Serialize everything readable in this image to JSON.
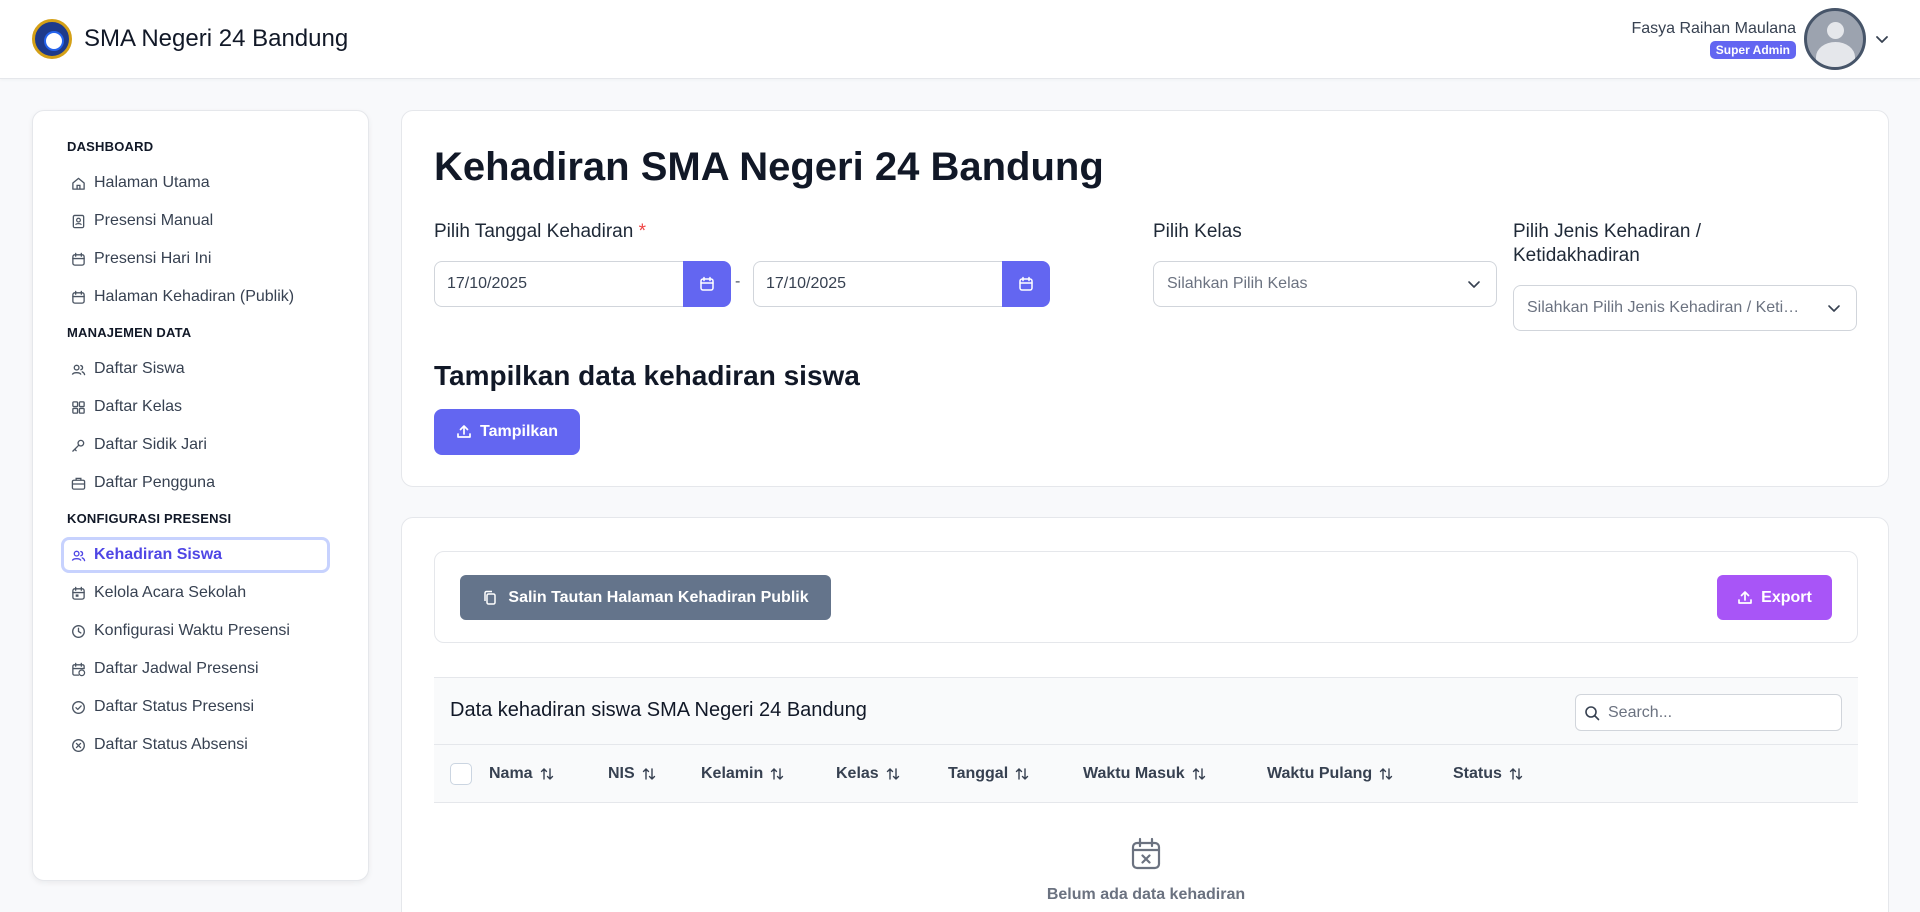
{
  "header": {
    "school_name": "SMA Negeri 24 Bandung",
    "user_name": "Fasya Raihan Maulana",
    "user_role": "Super Admin"
  },
  "sidebar": {
    "sections": [
      {
        "title": "DASHBOARD",
        "items": [
          {
            "label": "Halaman Utama",
            "icon": "home-icon"
          },
          {
            "label": "Presensi Manual",
            "icon": "contact-card-icon"
          },
          {
            "label": "Presensi Hari Ini",
            "icon": "calendar-icon"
          },
          {
            "label": "Halaman Kehadiran (Publik)",
            "icon": "calendar-icon"
          }
        ]
      },
      {
        "title": "MANAJEMEN DATA",
        "items": [
          {
            "label": "Daftar Siswa",
            "icon": "users-icon"
          },
          {
            "label": "Daftar Kelas",
            "icon": "grid-icon"
          },
          {
            "label": "Daftar Sidik Jari",
            "icon": "key-icon"
          },
          {
            "label": "Daftar Pengguna",
            "icon": "briefcase-icon"
          }
        ]
      },
      {
        "title": "KONFIGURASI PRESENSI",
        "items": [
          {
            "label": "Kehadiran Siswa",
            "icon": "users-icon",
            "active": true
          },
          {
            "label": "Kelola Acara Sekolah",
            "icon": "calendar-event-icon"
          },
          {
            "label": "Konfigurasi Waktu Presensi",
            "icon": "clock-icon"
          },
          {
            "label": "Daftar Jadwal Presensi",
            "icon": "calendar-clock-icon"
          },
          {
            "label": "Daftar Status Presensi",
            "icon": "check-circle-icon"
          },
          {
            "label": "Daftar Status Absensi",
            "icon": "x-circle-icon"
          }
        ]
      }
    ]
  },
  "filter_card": {
    "title": "Kehadiran SMA Negeri 24 Bandung",
    "date_label": "Pilih Tanggal Kehadiran",
    "required_mark": "*",
    "date_from": "17/10/2025",
    "date_separator": "-",
    "date_to": "17/10/2025",
    "class_label": "Pilih Kelas",
    "class_placeholder": "Silahkan Pilih Kelas",
    "type_label": "Pilih Jenis Kehadiran / Ketidakhadiran",
    "type_placeholder": "Silahkan Pilih Jenis Kehadiran / Ketidakhadiran",
    "show_title": "Tampilkan data kehadiran siswa",
    "show_button": "Tampilkan"
  },
  "data_card": {
    "copy_button": "Salin Tautan Halaman Kehadiran Publik",
    "export_button": "Export",
    "table_title": "Data kehadiran siswa SMA Negeri 24 Bandung",
    "search_placeholder": "Search...",
    "columns": [
      "Nama",
      "NIS",
      "Kelamin",
      "Kelas",
      "Tanggal",
      "Waktu Masuk",
      "Waktu Pulang",
      "Status"
    ],
    "empty_text": "Belum ada data kehadiran"
  },
  "colors": {
    "primary": "#6366f1",
    "export": "#a855f7",
    "copy": "#64748b",
    "required": "#ef4444"
  }
}
